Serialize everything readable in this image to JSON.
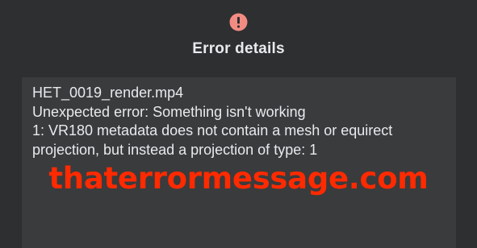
{
  "dialog": {
    "title": "Error details",
    "icon": "error-icon",
    "icon_color": "#f28b82",
    "details": {
      "lines": [
        "HET_0019_render.mp4",
        "Unexpected error: Something isn't working",
        "1: VR180 metadata does not contain a mesh or equirect",
        "projection, but instead a projection of type: 1"
      ]
    }
  },
  "watermark": {
    "text": "thaterrormessage.com",
    "color": "#ff2a00"
  }
}
